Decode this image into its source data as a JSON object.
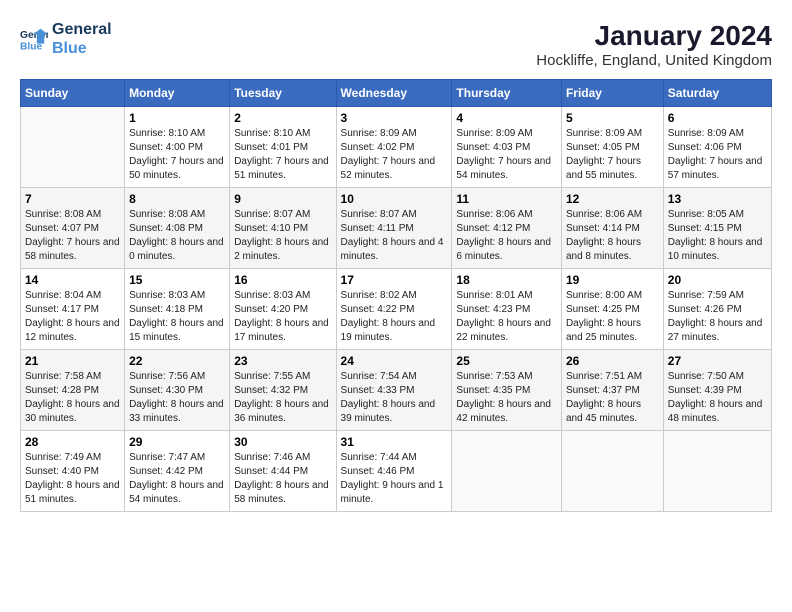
{
  "logo": {
    "line1": "General",
    "line2": "Blue"
  },
  "title": "January 2024",
  "subtitle": "Hockliffe, England, United Kingdom",
  "days_of_week": [
    "Sunday",
    "Monday",
    "Tuesday",
    "Wednesday",
    "Thursday",
    "Friday",
    "Saturday"
  ],
  "weeks": [
    [
      {
        "num": "",
        "sunrise": "",
        "sunset": "",
        "daylight": ""
      },
      {
        "num": "1",
        "sunrise": "Sunrise: 8:10 AM",
        "sunset": "Sunset: 4:00 PM",
        "daylight": "Daylight: 7 hours and 50 minutes."
      },
      {
        "num": "2",
        "sunrise": "Sunrise: 8:10 AM",
        "sunset": "Sunset: 4:01 PM",
        "daylight": "Daylight: 7 hours and 51 minutes."
      },
      {
        "num": "3",
        "sunrise": "Sunrise: 8:09 AM",
        "sunset": "Sunset: 4:02 PM",
        "daylight": "Daylight: 7 hours and 52 minutes."
      },
      {
        "num": "4",
        "sunrise": "Sunrise: 8:09 AM",
        "sunset": "Sunset: 4:03 PM",
        "daylight": "Daylight: 7 hours and 54 minutes."
      },
      {
        "num": "5",
        "sunrise": "Sunrise: 8:09 AM",
        "sunset": "Sunset: 4:05 PM",
        "daylight": "Daylight: 7 hours and 55 minutes."
      },
      {
        "num": "6",
        "sunrise": "Sunrise: 8:09 AM",
        "sunset": "Sunset: 4:06 PM",
        "daylight": "Daylight: 7 hours and 57 minutes."
      }
    ],
    [
      {
        "num": "7",
        "sunrise": "Sunrise: 8:08 AM",
        "sunset": "Sunset: 4:07 PM",
        "daylight": "Daylight: 7 hours and 58 minutes."
      },
      {
        "num": "8",
        "sunrise": "Sunrise: 8:08 AM",
        "sunset": "Sunset: 4:08 PM",
        "daylight": "Daylight: 8 hours and 0 minutes."
      },
      {
        "num": "9",
        "sunrise": "Sunrise: 8:07 AM",
        "sunset": "Sunset: 4:10 PM",
        "daylight": "Daylight: 8 hours and 2 minutes."
      },
      {
        "num": "10",
        "sunrise": "Sunrise: 8:07 AM",
        "sunset": "Sunset: 4:11 PM",
        "daylight": "Daylight: 8 hours and 4 minutes."
      },
      {
        "num": "11",
        "sunrise": "Sunrise: 8:06 AM",
        "sunset": "Sunset: 4:12 PM",
        "daylight": "Daylight: 8 hours and 6 minutes."
      },
      {
        "num": "12",
        "sunrise": "Sunrise: 8:06 AM",
        "sunset": "Sunset: 4:14 PM",
        "daylight": "Daylight: 8 hours and 8 minutes."
      },
      {
        "num": "13",
        "sunrise": "Sunrise: 8:05 AM",
        "sunset": "Sunset: 4:15 PM",
        "daylight": "Daylight: 8 hours and 10 minutes."
      }
    ],
    [
      {
        "num": "14",
        "sunrise": "Sunrise: 8:04 AM",
        "sunset": "Sunset: 4:17 PM",
        "daylight": "Daylight: 8 hours and 12 minutes."
      },
      {
        "num": "15",
        "sunrise": "Sunrise: 8:03 AM",
        "sunset": "Sunset: 4:18 PM",
        "daylight": "Daylight: 8 hours and 15 minutes."
      },
      {
        "num": "16",
        "sunrise": "Sunrise: 8:03 AM",
        "sunset": "Sunset: 4:20 PM",
        "daylight": "Daylight: 8 hours and 17 minutes."
      },
      {
        "num": "17",
        "sunrise": "Sunrise: 8:02 AM",
        "sunset": "Sunset: 4:22 PM",
        "daylight": "Daylight: 8 hours and 19 minutes."
      },
      {
        "num": "18",
        "sunrise": "Sunrise: 8:01 AM",
        "sunset": "Sunset: 4:23 PM",
        "daylight": "Daylight: 8 hours and 22 minutes."
      },
      {
        "num": "19",
        "sunrise": "Sunrise: 8:00 AM",
        "sunset": "Sunset: 4:25 PM",
        "daylight": "Daylight: 8 hours and 25 minutes."
      },
      {
        "num": "20",
        "sunrise": "Sunrise: 7:59 AM",
        "sunset": "Sunset: 4:26 PM",
        "daylight": "Daylight: 8 hours and 27 minutes."
      }
    ],
    [
      {
        "num": "21",
        "sunrise": "Sunrise: 7:58 AM",
        "sunset": "Sunset: 4:28 PM",
        "daylight": "Daylight: 8 hours and 30 minutes."
      },
      {
        "num": "22",
        "sunrise": "Sunrise: 7:56 AM",
        "sunset": "Sunset: 4:30 PM",
        "daylight": "Daylight: 8 hours and 33 minutes."
      },
      {
        "num": "23",
        "sunrise": "Sunrise: 7:55 AM",
        "sunset": "Sunset: 4:32 PM",
        "daylight": "Daylight: 8 hours and 36 minutes."
      },
      {
        "num": "24",
        "sunrise": "Sunrise: 7:54 AM",
        "sunset": "Sunset: 4:33 PM",
        "daylight": "Daylight: 8 hours and 39 minutes."
      },
      {
        "num": "25",
        "sunrise": "Sunrise: 7:53 AM",
        "sunset": "Sunset: 4:35 PM",
        "daylight": "Daylight: 8 hours and 42 minutes."
      },
      {
        "num": "26",
        "sunrise": "Sunrise: 7:51 AM",
        "sunset": "Sunset: 4:37 PM",
        "daylight": "Daylight: 8 hours and 45 minutes."
      },
      {
        "num": "27",
        "sunrise": "Sunrise: 7:50 AM",
        "sunset": "Sunset: 4:39 PM",
        "daylight": "Daylight: 8 hours and 48 minutes."
      }
    ],
    [
      {
        "num": "28",
        "sunrise": "Sunrise: 7:49 AM",
        "sunset": "Sunset: 4:40 PM",
        "daylight": "Daylight: 8 hours and 51 minutes."
      },
      {
        "num": "29",
        "sunrise": "Sunrise: 7:47 AM",
        "sunset": "Sunset: 4:42 PM",
        "daylight": "Daylight: 8 hours and 54 minutes."
      },
      {
        "num": "30",
        "sunrise": "Sunrise: 7:46 AM",
        "sunset": "Sunset: 4:44 PM",
        "daylight": "Daylight: 8 hours and 58 minutes."
      },
      {
        "num": "31",
        "sunrise": "Sunrise: 7:44 AM",
        "sunset": "Sunset: 4:46 PM",
        "daylight": "Daylight: 9 hours and 1 minute."
      },
      {
        "num": "",
        "sunrise": "",
        "sunset": "",
        "daylight": ""
      },
      {
        "num": "",
        "sunrise": "",
        "sunset": "",
        "daylight": ""
      },
      {
        "num": "",
        "sunrise": "",
        "sunset": "",
        "daylight": ""
      }
    ]
  ]
}
